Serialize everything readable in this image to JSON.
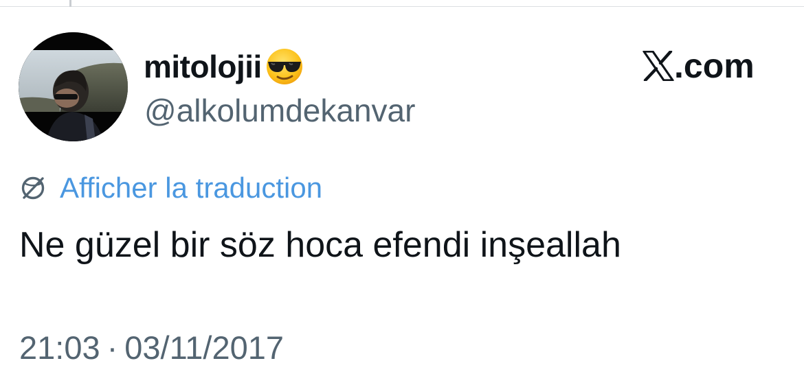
{
  "user": {
    "display_name": "mitolojii",
    "display_name_emoji": "sunglasses-face-emoji",
    "handle": "@alkolumdekanvar",
    "avatar": "profile-photo-man-with-sunglasses"
  },
  "brand": {
    "logo_icon": "x-logo-icon",
    "text": ".com"
  },
  "translation": {
    "icon": "translate-globe-icon",
    "link_text": "Afficher la traduction"
  },
  "tweet": {
    "text": "Ne güzel bir söz hoca efendi inşeallah"
  },
  "meta": {
    "time": "21:03",
    "separator": "·",
    "date": "03/11/2017"
  },
  "colors": {
    "text_primary": "#0f1419",
    "text_secondary": "#536471",
    "link": "#4a97e0"
  }
}
